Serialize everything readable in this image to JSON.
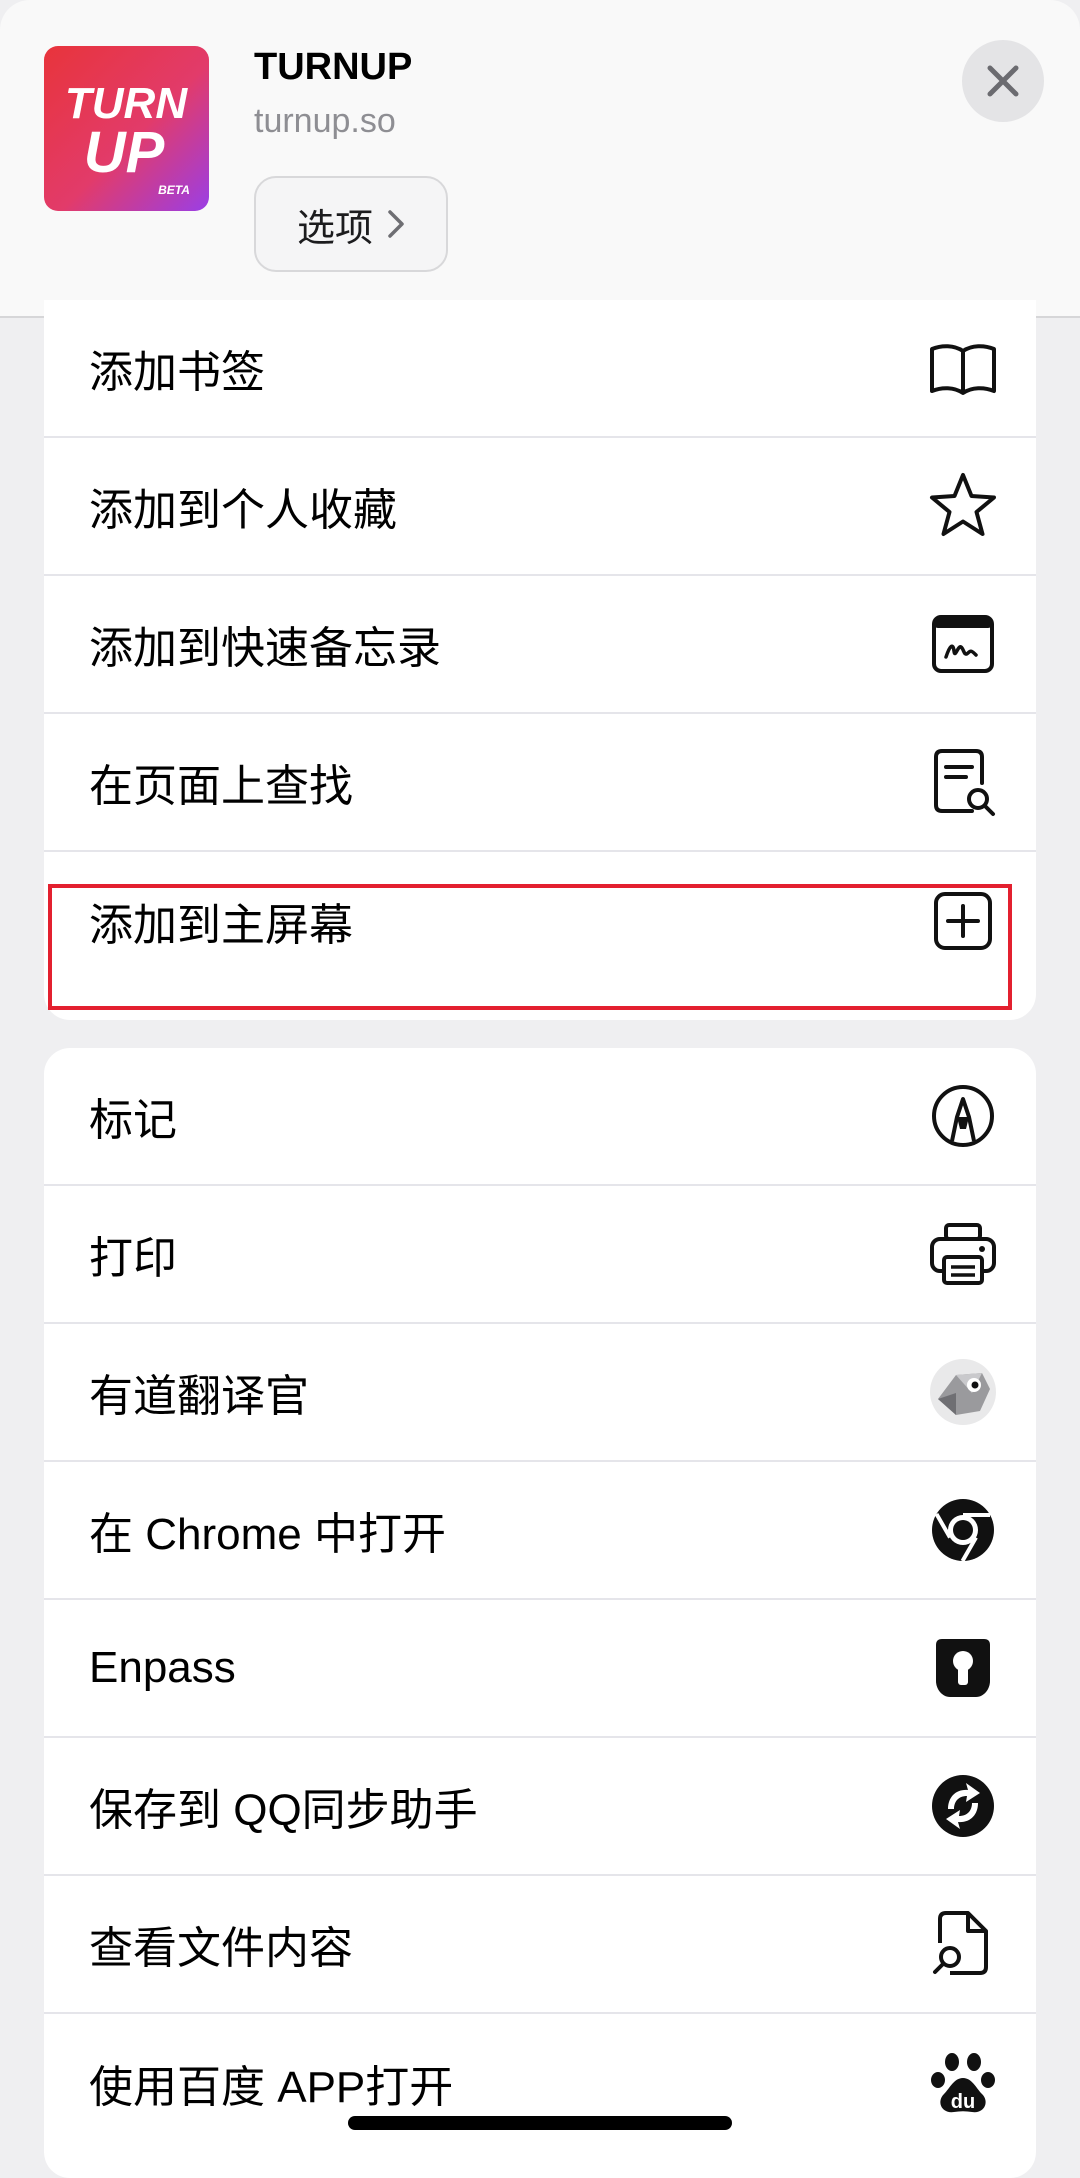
{
  "header": {
    "app_name": "TURNUP",
    "url": "turnup.so",
    "options_label": "选项",
    "logo_text_top": "TURN",
    "logo_text_bottom": "UP",
    "logo_badge": "BETA"
  },
  "menu_group_1": [
    {
      "label": "添加书签",
      "icon": "book-icon"
    },
    {
      "label": "添加到个人收藏",
      "icon": "star-icon"
    },
    {
      "label": "添加到快速备忘录",
      "icon": "quick-note-icon"
    },
    {
      "label": "在页面上查找",
      "icon": "find-on-page-icon"
    },
    {
      "label": "添加到主屏幕",
      "icon": "add-square-icon"
    }
  ],
  "menu_group_2": [
    {
      "label": "标记",
      "icon": "markup-icon"
    },
    {
      "label": "打印",
      "icon": "printer-icon"
    },
    {
      "label": "有道翻译官",
      "icon": "youdao-icon"
    },
    {
      "label": "在 Chrome 中打开",
      "icon": "chrome-icon"
    },
    {
      "label": "Enpass",
      "icon": "enpass-icon"
    },
    {
      "label": "保存到 QQ同步助手",
      "icon": "sync-icon"
    },
    {
      "label": "查看文件内容",
      "icon": "file-search-icon"
    },
    {
      "label": "使用百度 APP打开",
      "icon": "baidu-icon"
    }
  ],
  "colors": {
    "highlight": "#e3202f",
    "background": "#efeff1"
  }
}
